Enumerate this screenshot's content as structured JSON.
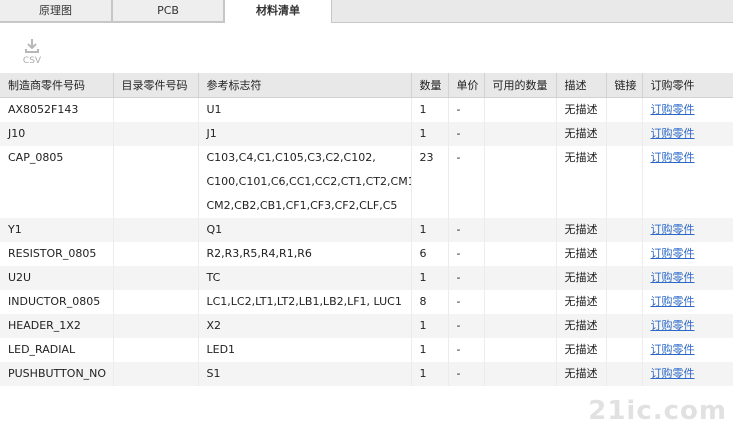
{
  "tabs": [
    {
      "label": "原理图",
      "active": false
    },
    {
      "label": "PCB",
      "active": false
    },
    {
      "label": "材料清单",
      "active": true
    }
  ],
  "toolbar": {
    "csv_label": "CSV",
    "csv_icon": "download-icon"
  },
  "table": {
    "columns": [
      "制造商零件号码",
      "目录零件号码",
      "参考标志符",
      "数量",
      "单价",
      "可用的数量",
      "描述",
      "链接",
      "订购零件"
    ],
    "rows": [
      {
        "mfr": "AX8052F143",
        "catalog": "",
        "refs": "U1",
        "qty": "1",
        "price": "-",
        "avail": "",
        "desc": "无描述",
        "link": "",
        "order": "订购零件"
      },
      {
        "mfr": "J10",
        "catalog": "",
        "refs": "J1",
        "qty": "1",
        "price": "-",
        "avail": "",
        "desc": "无描述",
        "link": "",
        "order": "订购零件"
      },
      {
        "mfr": "CAP_0805",
        "catalog": "",
        "refs": "C103,C4,C1,C105,C3,C2,C102, C100,C101,C6,CC1,CC2,CT1,CT2,CM1, CM2,CB2,CB1,CF1,CF3,CF2,CLF,C5",
        "qty": "23",
        "price": "-",
        "avail": "",
        "desc": "无描述",
        "link": "",
        "order": "订购零件"
      },
      {
        "mfr": "Y1",
        "catalog": "",
        "refs": "Q1",
        "qty": "1",
        "price": "-",
        "avail": "",
        "desc": "无描述",
        "link": "",
        "order": "订购零件"
      },
      {
        "mfr": "RESISTOR_0805",
        "catalog": "",
        "refs": "R2,R3,R5,R4,R1,R6",
        "qty": "6",
        "price": "-",
        "avail": "",
        "desc": "无描述",
        "link": "",
        "order": "订购零件"
      },
      {
        "mfr": "U2U",
        "catalog": "",
        "refs": "TC",
        "qty": "1",
        "price": "-",
        "avail": "",
        "desc": "无描述",
        "link": "",
        "order": "订购零件"
      },
      {
        "mfr": "INDUCTOR_0805",
        "catalog": "",
        "refs": "LC1,LC2,LT1,LT2,LB1,LB2,LF1, LUC1",
        "qty": "8",
        "price": "-",
        "avail": "",
        "desc": "无描述",
        "link": "",
        "order": "订购零件"
      },
      {
        "mfr": "HEADER_1X2",
        "catalog": "",
        "refs": "X2",
        "qty": "1",
        "price": "-",
        "avail": "",
        "desc": "无描述",
        "link": "",
        "order": "订购零件"
      },
      {
        "mfr": "LED_RADIAL",
        "catalog": "",
        "refs": "LED1",
        "qty": "1",
        "price": "-",
        "avail": "",
        "desc": "无描述",
        "link": "",
        "order": "订购零件"
      },
      {
        "mfr": "PUSHBUTTON_NO",
        "catalog": "",
        "refs": "S1",
        "qty": "1",
        "price": "-",
        "avail": "",
        "desc": "无描述",
        "link": "",
        "order": "订购零件"
      }
    ]
  },
  "watermark": "21ic.com",
  "colors": {
    "link": "#2b68c8",
    "header_bg": "#e8e8e8",
    "tabbar_bg": "#e9e9e9"
  }
}
